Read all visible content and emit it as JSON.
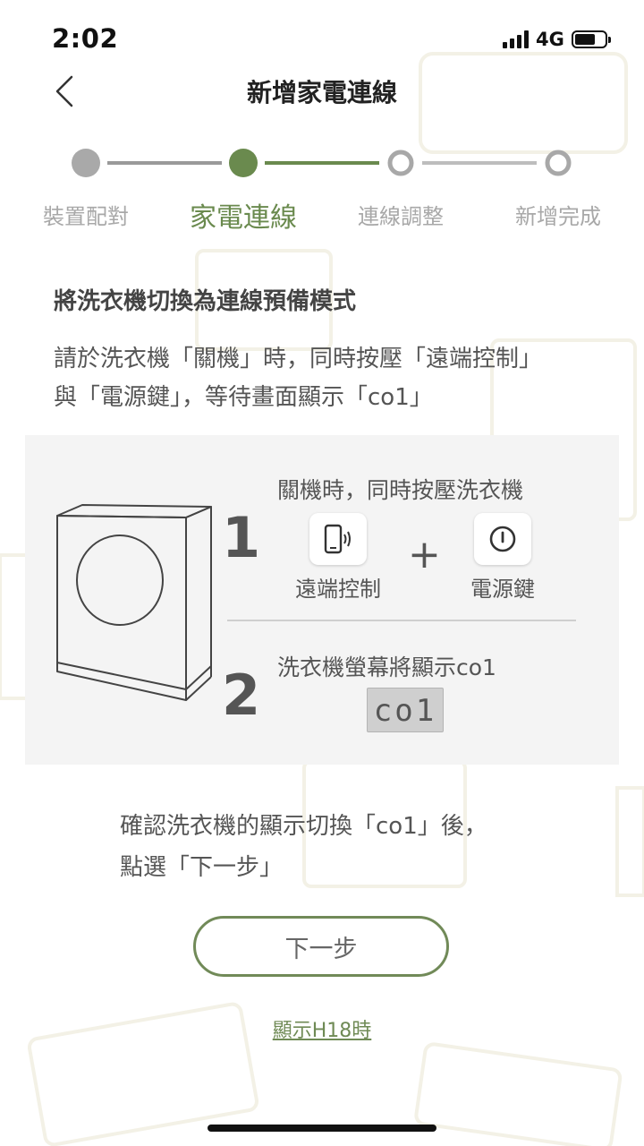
{
  "status_bar": {
    "time": "2:02",
    "network": "4G",
    "icons": [
      "signal-icon",
      "battery-icon"
    ]
  },
  "header": {
    "title": "新增家電連線",
    "back_icon": "chevron-left-icon"
  },
  "stepper": {
    "steps": [
      {
        "label": "裝置配對",
        "state": "done"
      },
      {
        "label": "家電連線",
        "state": "active"
      },
      {
        "label": "連線調整",
        "state": "pending"
      },
      {
        "label": "新增完成",
        "state": "pending"
      }
    ]
  },
  "instructions": {
    "heading": "將洗衣機切換為連線預備模式",
    "desc_line1": "請於洗衣機「關機」時，同時按壓「遠端控制」",
    "desc_line2": "與「電源鍵」，等待畫面顯示「co1」"
  },
  "illustration": {
    "step1": {
      "number": "1",
      "text": "關機時，同時按壓洗衣機",
      "key1_label": "遠端控制",
      "key1_icon": "remote-phone-icon",
      "plus": "+",
      "key2_label": "電源鍵",
      "key2_icon": "power-icon"
    },
    "step2": {
      "number": "2",
      "text": "洗衣機螢幕將顯示co1",
      "lcd_text": "co1"
    }
  },
  "confirm": {
    "line1": "確認洗衣機的顯示切換「co1」後，",
    "line2": "點選「下一步」"
  },
  "buttons": {
    "next_label": "下一步",
    "h18_link": "顯示H18時"
  },
  "colors": {
    "accent": "#6a8a4e",
    "button_border": "#718a58",
    "inactive": "#a8a8a8",
    "done_dot": "#a9a9a9"
  }
}
